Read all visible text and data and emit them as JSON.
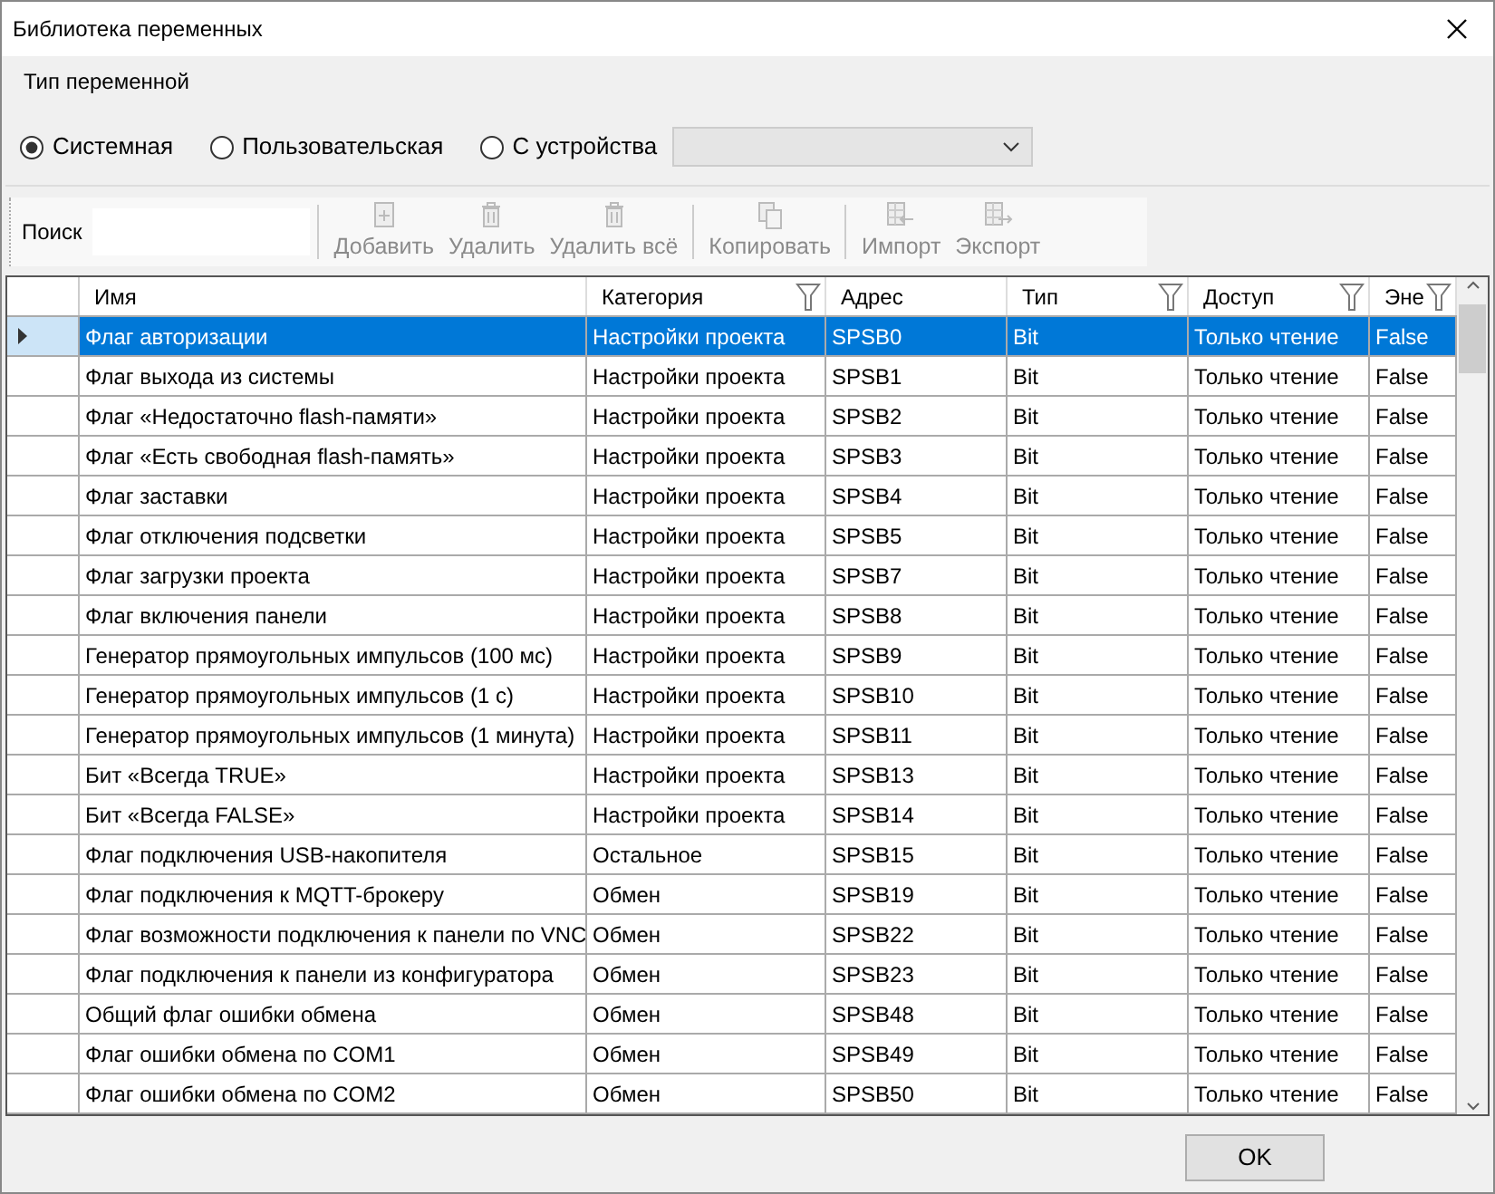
{
  "window": {
    "title": "Библиотека переменных"
  },
  "variable_type": {
    "label": "Тип переменной",
    "options": [
      {
        "label": "Системная",
        "selected": true
      },
      {
        "label": "Пользовательская",
        "selected": false
      },
      {
        "label": "С устройства",
        "selected": false
      }
    ],
    "device_dropdown": {
      "disabled": true
    }
  },
  "toolbar": {
    "search_label": "Поиск",
    "buttons": [
      {
        "label": "Добавить",
        "disabled": true
      },
      {
        "label": "Удалить",
        "disabled": true
      },
      {
        "label": "Удалить всё",
        "disabled": true
      },
      {
        "label": "Копировать",
        "disabled": true
      },
      {
        "label": "Импорт",
        "disabled": true
      },
      {
        "label": "Экспорт",
        "disabled": true
      }
    ]
  },
  "table": {
    "columns": [
      {
        "label": "Имя",
        "filter": false
      },
      {
        "label": "Категория",
        "filter": true
      },
      {
        "label": "Адрес",
        "filter": false
      },
      {
        "label": "Тип",
        "filter": true
      },
      {
        "label": "Доступ",
        "filter": true
      },
      {
        "label": "Эне",
        "filter": true
      }
    ],
    "rows": [
      {
        "selected": true,
        "cells": [
          "Флаг авторизации",
          "Настройки проекта",
          "SPSB0",
          "Bit",
          "Только чтение",
          "False"
        ]
      },
      {
        "selected": false,
        "cells": [
          "Флаг выхода из системы",
          "Настройки проекта",
          "SPSB1",
          "Bit",
          "Только чтение",
          "False"
        ]
      },
      {
        "selected": false,
        "cells": [
          "Флаг «Недостаточно flash-памяти»",
          "Настройки проекта",
          "SPSB2",
          "Bit",
          "Только чтение",
          "False"
        ]
      },
      {
        "selected": false,
        "cells": [
          "Флаг «Есть свободная flash-память»",
          "Настройки проекта",
          "SPSB3",
          "Bit",
          "Только чтение",
          "False"
        ]
      },
      {
        "selected": false,
        "cells": [
          "Флаг заставки",
          "Настройки проекта",
          "SPSB4",
          "Bit",
          "Только чтение",
          "False"
        ]
      },
      {
        "selected": false,
        "cells": [
          "Флаг отключения подсветки",
          "Настройки проекта",
          "SPSB5",
          "Bit",
          "Только чтение",
          "False"
        ]
      },
      {
        "selected": false,
        "cells": [
          "Флаг загрузки проекта",
          "Настройки проекта",
          "SPSB7",
          "Bit",
          "Только чтение",
          "False"
        ]
      },
      {
        "selected": false,
        "cells": [
          "Флаг включения панели",
          "Настройки проекта",
          "SPSB8",
          "Bit",
          "Только чтение",
          "False"
        ]
      },
      {
        "selected": false,
        "cells": [
          "Генератор прямоугольных импульсов (100 мс)",
          "Настройки проекта",
          "SPSB9",
          "Bit",
          "Только чтение",
          "False"
        ]
      },
      {
        "selected": false,
        "cells": [
          "Генератор прямоугольных импульсов (1 с)",
          "Настройки проекта",
          "SPSB10",
          "Bit",
          "Только чтение",
          "False"
        ]
      },
      {
        "selected": false,
        "cells": [
          "Генератор прямоугольных импульсов (1 минута)",
          "Настройки проекта",
          "SPSB11",
          "Bit",
          "Только чтение",
          "False"
        ]
      },
      {
        "selected": false,
        "cells": [
          "Бит «Всегда TRUE»",
          "Настройки проекта",
          "SPSB13",
          "Bit",
          "Только чтение",
          "False"
        ]
      },
      {
        "selected": false,
        "cells": [
          "Бит «Всегда FALSE»",
          "Настройки проекта",
          "SPSB14",
          "Bit",
          "Только чтение",
          "False"
        ]
      },
      {
        "selected": false,
        "cells": [
          "Флаг подключения USB-накопителя",
          "Остальное",
          "SPSB15",
          "Bit",
          "Только чтение",
          "False"
        ]
      },
      {
        "selected": false,
        "cells": [
          "Флаг подключения к MQTT-брокеру",
          "Обмен",
          "SPSB19",
          "Bit",
          "Только чтение",
          "False"
        ]
      },
      {
        "selected": false,
        "cells": [
          "Флаг возможности подключения к панели по VNC",
          "Обмен",
          "SPSB22",
          "Bit",
          "Только чтение",
          "False"
        ]
      },
      {
        "selected": false,
        "cells": [
          "Флаг подключения к панели из конфигуратора",
          "Обмен",
          "SPSB23",
          "Bit",
          "Только чтение",
          "False"
        ]
      },
      {
        "selected": false,
        "cells": [
          "Общий флаг ошибки обмена",
          "Обмен",
          "SPSB48",
          "Bit",
          "Только чтение",
          "False"
        ]
      },
      {
        "selected": false,
        "cells": [
          "Флаг ошибки обмена по COM1",
          "Обмен",
          "SPSB49",
          "Bit",
          "Только чтение",
          "False"
        ]
      },
      {
        "selected": false,
        "cells": [
          "Флаг ошибки обмена по COM2",
          "Обмен",
          "SPSB50",
          "Bit",
          "Только чтение",
          "False"
        ]
      }
    ]
  },
  "footer": {
    "ok_button": "OK"
  }
}
